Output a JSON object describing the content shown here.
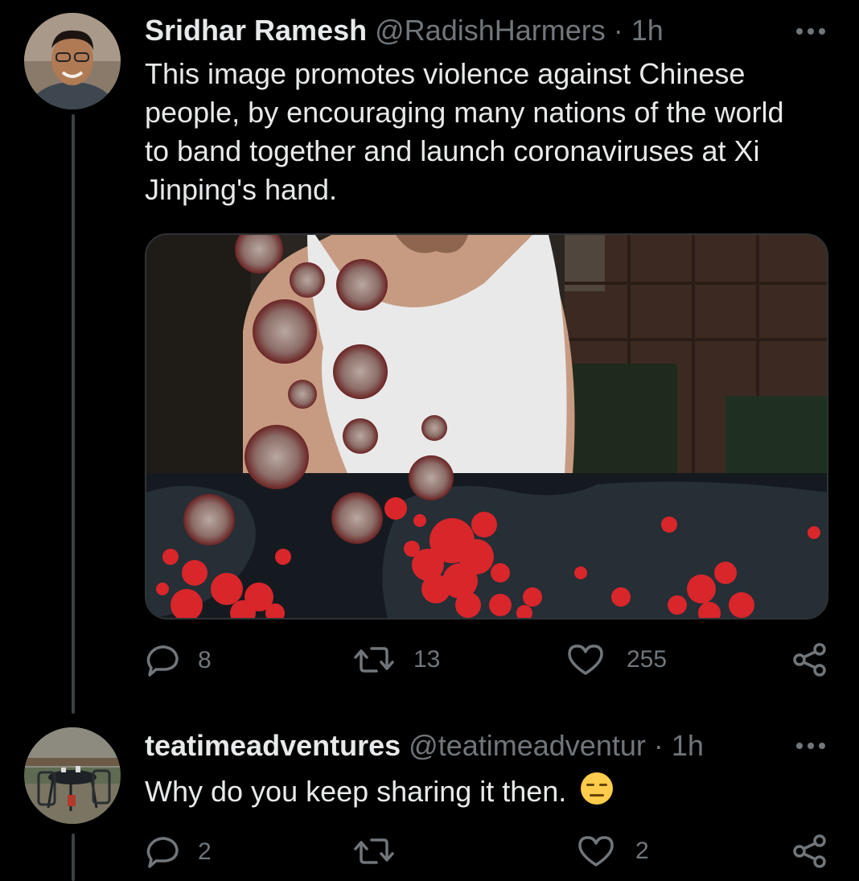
{
  "tweets": [
    {
      "author": {
        "name": "Sridhar Ramesh",
        "handle": "@RadishHarmers",
        "time": "1h"
      },
      "text": [
        "This image promotes violence against Chinese",
        "people, by encouraging many nations of the world",
        "to band together and launch coronaviruses at Xi",
        "Jinping's hand."
      ],
      "media": {
        "description_icon": "meme-image"
      },
      "actions": {
        "replies": "8",
        "retweets": "13",
        "likes": "255"
      }
    },
    {
      "author": {
        "name": "teatimeadventures",
        "handle": "@teatimeadventur",
        "time": "1h"
      },
      "text": "Why do you keep sharing it then.",
      "emoji": "expressionless-face",
      "actions": {
        "replies": "2",
        "retweets": "",
        "likes": "2"
      }
    }
  ],
  "separator": "·",
  "colors": {
    "background": "#000000",
    "text": "#e7e9ea",
    "muted": "#71767b",
    "virus": "#d8262a",
    "border": "#2f3336"
  }
}
